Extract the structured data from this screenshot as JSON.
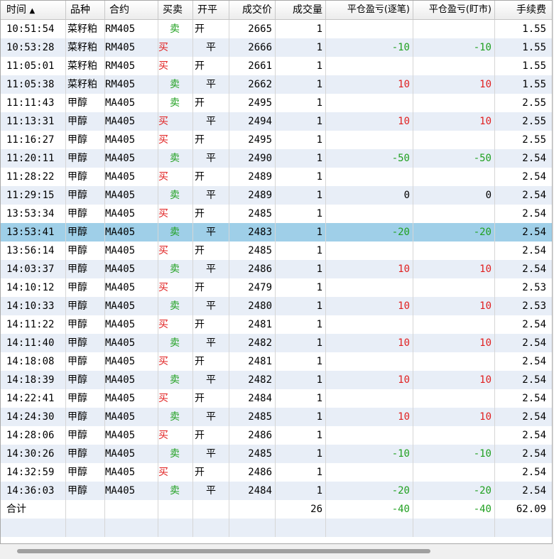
{
  "header": {
    "time": "时间",
    "sort_arrow": "▲",
    "product": "品种",
    "contract": "合约",
    "side": "买卖",
    "open_close": "开平",
    "price": "成交价",
    "volume": "成交量",
    "pnl_close": "平仓盈亏(逐笔)",
    "pnl_mark": "平仓盈亏(盯市)",
    "fee": "手续费"
  },
  "rows": [
    {
      "time": "10:51:54",
      "product": "菜籽粕",
      "contract": "RM405",
      "side": "卖",
      "oc": "开",
      "price": "2665",
      "vol": "1",
      "pnl1": "",
      "pnl2": "",
      "fee": "1.55"
    },
    {
      "time": "10:53:28",
      "product": "菜籽粕",
      "contract": "RM405",
      "side": "买",
      "oc": "平",
      "price": "2666",
      "vol": "1",
      "pnl1": "-10",
      "pnl2": "-10",
      "fee": "1.55"
    },
    {
      "time": "11:05:01",
      "product": "菜籽粕",
      "contract": "RM405",
      "side": "买",
      "oc": "开",
      "price": "2661",
      "vol": "1",
      "pnl1": "",
      "pnl2": "",
      "fee": "1.55"
    },
    {
      "time": "11:05:38",
      "product": "菜籽粕",
      "contract": "RM405",
      "side": "卖",
      "oc": "平",
      "price": "2662",
      "vol": "1",
      "pnl1": "10",
      "pnl2": "10",
      "fee": "1.55"
    },
    {
      "time": "11:11:43",
      "product": "甲醇",
      "contract": "MA405",
      "side": "卖",
      "oc": "开",
      "price": "2495",
      "vol": "1",
      "pnl1": "",
      "pnl2": "",
      "fee": "2.55"
    },
    {
      "time": "11:13:31",
      "product": "甲醇",
      "contract": "MA405",
      "side": "买",
      "oc": "平",
      "price": "2494",
      "vol": "1",
      "pnl1": "10",
      "pnl2": "10",
      "fee": "2.55"
    },
    {
      "time": "11:16:27",
      "product": "甲醇",
      "contract": "MA405",
      "side": "买",
      "oc": "开",
      "price": "2495",
      "vol": "1",
      "pnl1": "",
      "pnl2": "",
      "fee": "2.55"
    },
    {
      "time": "11:20:11",
      "product": "甲醇",
      "contract": "MA405",
      "side": "卖",
      "oc": "平",
      "price": "2490",
      "vol": "1",
      "pnl1": "-50",
      "pnl2": "-50",
      "fee": "2.54"
    },
    {
      "time": "11:28:22",
      "product": "甲醇",
      "contract": "MA405",
      "side": "买",
      "oc": "开",
      "price": "2489",
      "vol": "1",
      "pnl1": "",
      "pnl2": "",
      "fee": "2.54"
    },
    {
      "time": "11:29:15",
      "product": "甲醇",
      "contract": "MA405",
      "side": "卖",
      "oc": "平",
      "price": "2489",
      "vol": "1",
      "pnl1": "0",
      "pnl2": "0",
      "fee": "2.54"
    },
    {
      "time": "13:53:34",
      "product": "甲醇",
      "contract": "MA405",
      "side": "买",
      "oc": "开",
      "price": "2485",
      "vol": "1",
      "pnl1": "",
      "pnl2": "",
      "fee": "2.54"
    },
    {
      "time": "13:53:41",
      "product": "甲醇",
      "contract": "MA405",
      "side": "卖",
      "oc": "平",
      "price": "2483",
      "vol": "1",
      "pnl1": "-20",
      "pnl2": "-20",
      "fee": "2.54",
      "selected": true
    },
    {
      "time": "13:56:14",
      "product": "甲醇",
      "contract": "MA405",
      "side": "买",
      "oc": "开",
      "price": "2485",
      "vol": "1",
      "pnl1": "",
      "pnl2": "",
      "fee": "2.54"
    },
    {
      "time": "14:03:37",
      "product": "甲醇",
      "contract": "MA405",
      "side": "卖",
      "oc": "平",
      "price": "2486",
      "vol": "1",
      "pnl1": "10",
      "pnl2": "10",
      "fee": "2.54"
    },
    {
      "time": "14:10:12",
      "product": "甲醇",
      "contract": "MA405",
      "side": "买",
      "oc": "开",
      "price": "2479",
      "vol": "1",
      "pnl1": "",
      "pnl2": "",
      "fee": "2.53"
    },
    {
      "time": "14:10:33",
      "product": "甲醇",
      "contract": "MA405",
      "side": "卖",
      "oc": "平",
      "price": "2480",
      "vol": "1",
      "pnl1": "10",
      "pnl2": "10",
      "fee": "2.53"
    },
    {
      "time": "14:11:22",
      "product": "甲醇",
      "contract": "MA405",
      "side": "买",
      "oc": "开",
      "price": "2481",
      "vol": "1",
      "pnl1": "",
      "pnl2": "",
      "fee": "2.54"
    },
    {
      "time": "14:11:40",
      "product": "甲醇",
      "contract": "MA405",
      "side": "卖",
      "oc": "平",
      "price": "2482",
      "vol": "1",
      "pnl1": "10",
      "pnl2": "10",
      "fee": "2.54"
    },
    {
      "time": "14:18:08",
      "product": "甲醇",
      "contract": "MA405",
      "side": "买",
      "oc": "开",
      "price": "2481",
      "vol": "1",
      "pnl1": "",
      "pnl2": "",
      "fee": "2.54"
    },
    {
      "time": "14:18:39",
      "product": "甲醇",
      "contract": "MA405",
      "side": "卖",
      "oc": "平",
      "price": "2482",
      "vol": "1",
      "pnl1": "10",
      "pnl2": "10",
      "fee": "2.54"
    },
    {
      "time": "14:22:41",
      "product": "甲醇",
      "contract": "MA405",
      "side": "买",
      "oc": "开",
      "price": "2484",
      "vol": "1",
      "pnl1": "",
      "pnl2": "",
      "fee": "2.54"
    },
    {
      "time": "14:24:30",
      "product": "甲醇",
      "contract": "MA405",
      "side": "卖",
      "oc": "平",
      "price": "2485",
      "vol": "1",
      "pnl1": "10",
      "pnl2": "10",
      "fee": "2.54"
    },
    {
      "time": "14:28:06",
      "product": "甲醇",
      "contract": "MA405",
      "side": "买",
      "oc": "开",
      "price": "2486",
      "vol": "1",
      "pnl1": "",
      "pnl2": "",
      "fee": "2.54"
    },
    {
      "time": "14:30:26",
      "product": "甲醇",
      "contract": "MA405",
      "side": "卖",
      "oc": "平",
      "price": "2485",
      "vol": "1",
      "pnl1": "-10",
      "pnl2": "-10",
      "fee": "2.54"
    },
    {
      "time": "14:32:59",
      "product": "甲醇",
      "contract": "MA405",
      "side": "买",
      "oc": "开",
      "price": "2486",
      "vol": "1",
      "pnl1": "",
      "pnl2": "",
      "fee": "2.54"
    },
    {
      "time": "14:36:03",
      "product": "甲醇",
      "contract": "MA405",
      "side": "卖",
      "oc": "平",
      "price": "2484",
      "vol": "1",
      "pnl1": "-20",
      "pnl2": "-20",
      "fee": "2.54"
    }
  ],
  "total": {
    "label": "合计",
    "volume": "26",
    "pnl_close": "-40",
    "pnl_mark": "-40",
    "fee": "62.09"
  },
  "colors": {
    "buy": "#e02020",
    "sell": "#20a020",
    "selected_row": "#9fcfe8",
    "alt_row": "#e8eef7"
  }
}
